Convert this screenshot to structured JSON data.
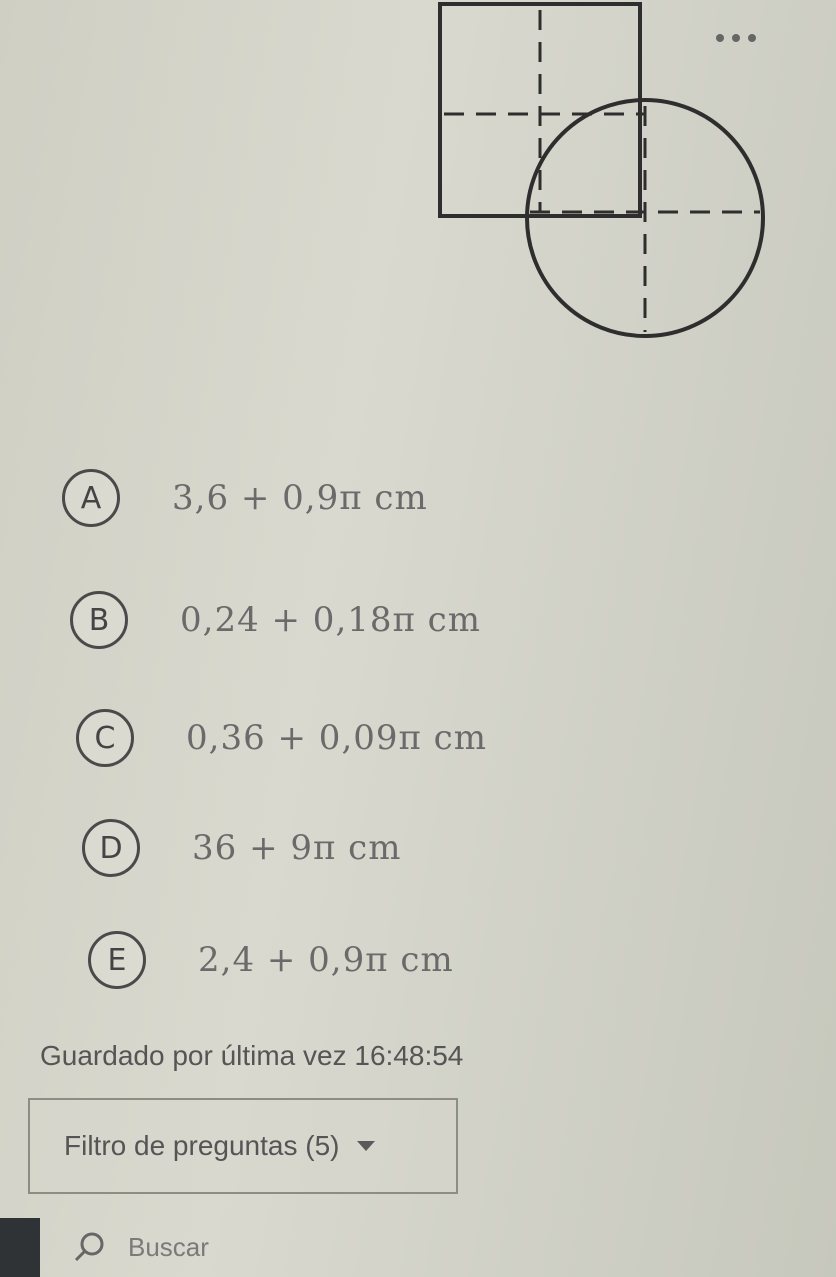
{
  "question": {
    "options": [
      {
        "letter": "A",
        "text": "3,6 + 0,9π cm"
      },
      {
        "letter": "B",
        "text": "0,24 + 0,18π cm"
      },
      {
        "letter": "C",
        "text": "0,36 + 0,09π cm"
      },
      {
        "letter": "D",
        "text": "36 + 9π cm"
      },
      {
        "letter": "E",
        "text": "2,4 + 0,9π cm"
      }
    ]
  },
  "status": {
    "saved_text": "Guardado por última vez 16:48:54"
  },
  "filter": {
    "label": "Filtro de preguntas (5)"
  },
  "taskbar": {
    "search_placeholder": "Buscar"
  },
  "icons": {
    "more": "more-dots-icon",
    "filter_caret": "caret-down-icon",
    "search": "search-icon"
  }
}
